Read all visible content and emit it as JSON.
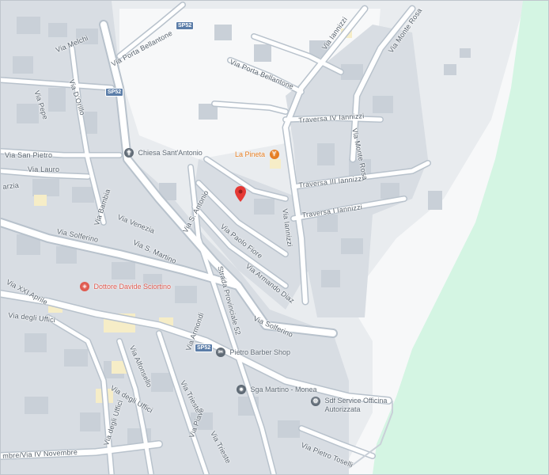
{
  "map": {
    "colors": {
      "background": "#e9ecef",
      "road": "#ffffff",
      "park": "#d4f5e3",
      "poi_orange": "#e67e22",
      "poi_red": "#e05a4f",
      "poi_gray": "#5f6a75",
      "pin_red": "#e53935",
      "shield": "#5b7da8"
    },
    "streets": [
      "Via Melchi",
      "Via Porta Bellantone",
      "Via Porta Bellantone",
      "Via Iannizzi",
      "Via Monte Rosa",
      "Via D'Orillo",
      "Via Pepe",
      "Via San Pietro",
      "Via Lauro",
      "Via Bambia",
      "Via Venezia",
      "Via S. Martino",
      "Via S. Antonio",
      "Via Solferino",
      "Via Paolo Fiore",
      "Via Armando Diaz",
      "Via Iannizzi",
      "Traversa IV Iannizzi",
      "Traversa III Iannizzi",
      "Traversa I Iannizzi",
      "Via Monte Rosa",
      "Strada Provinciale 52",
      "Via Solferino",
      "Via XXI Aprile",
      "Via degli Uffici",
      "Via Alfonsello",
      "Via Armondi",
      "Via degli Uffici",
      "Via degli Uffici",
      "Via Trieste",
      "Via Piave",
      "Via Trieste",
      "Via Pietro Toselli",
      "Via IV Novembre"
    ],
    "shields": [
      "SP52",
      "SP52",
      "SP52"
    ],
    "pois": [
      {
        "name": "Chiesa Sant'Antonio",
        "icon": "church-icon"
      },
      {
        "name": "La Pineta",
        "icon": "restaurant-icon"
      },
      {
        "name": "Dottore Davide Sciortino",
        "icon": "medical-icon"
      },
      {
        "name": "Pietro Barber Shop",
        "icon": "barber-icon"
      },
      {
        "name": "Sga Martino - Monea",
        "icon": "place-icon"
      },
      {
        "name": "Sdf Service Officina Autorizzata",
        "icon": "car-repair-icon"
      }
    ],
    "marker": "location-pin-icon",
    "partial_label": "arzia",
    "bottom_label": "mbre/Via IV Novembre"
  }
}
